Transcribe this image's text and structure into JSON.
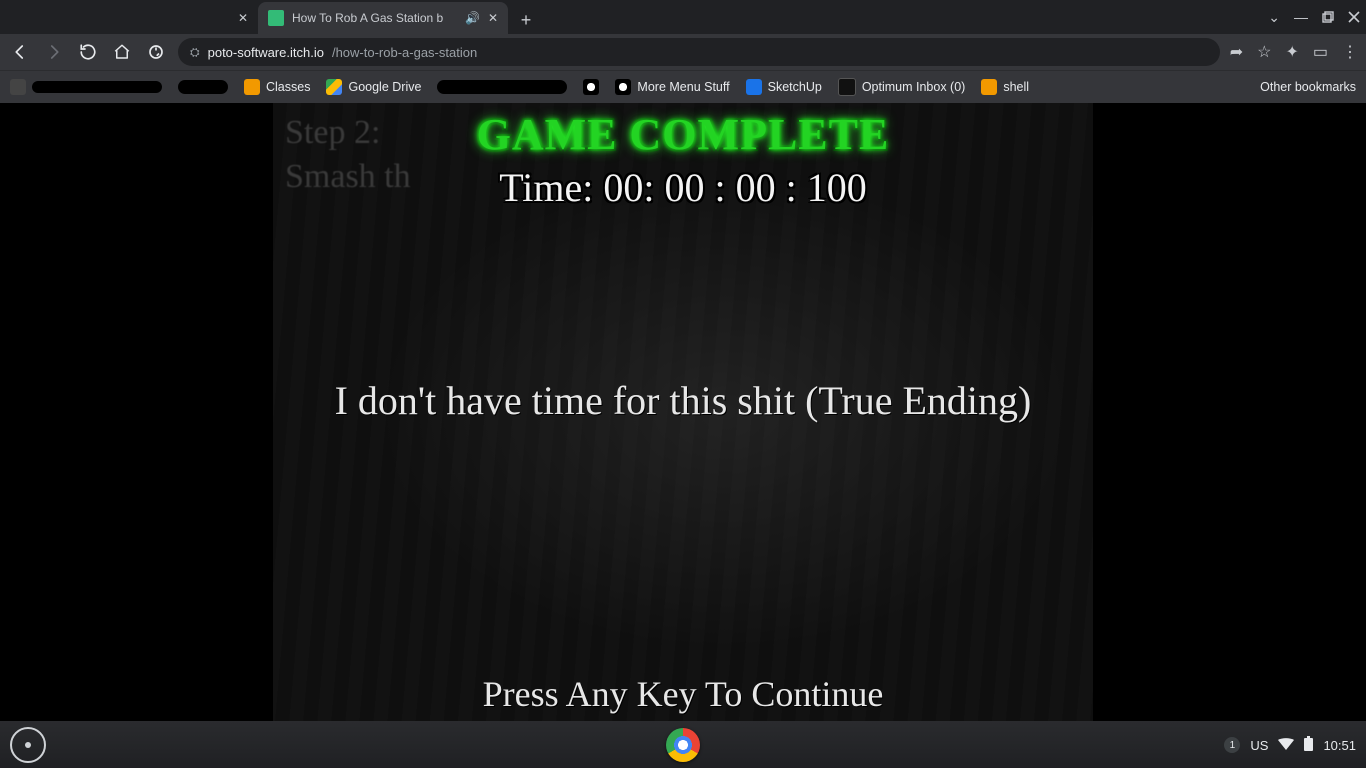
{
  "browser": {
    "tabs": {
      "inactive_close_glyph": "✕",
      "active": {
        "title": "How To Rob A Gas Station b",
        "audio_glyph": "🔊",
        "close_glyph": "✕"
      },
      "newtab_glyph": "+"
    },
    "window_controls": {
      "dropdown_glyph": "⌄",
      "minimize_glyph": "—"
    },
    "toolbar": {
      "secure_glyph": "⛭",
      "url_host": "poto-software.itch.io",
      "url_path": "/how-to-rob-a-gas-station",
      "share_glyph": "➦",
      "star_glyph": "☆",
      "ext_glyph": "✦",
      "panel_glyph": "▭",
      "menu_glyph": "⋮"
    },
    "bookmarks": {
      "items": [
        {
          "label": "Classes",
          "color": "#f29900"
        },
        {
          "label": "Google Drive",
          "color": "#34a853"
        },
        {
          "label": "More Menu Stuff",
          "color": "#9aa0a6"
        },
        {
          "label": "SketchUp",
          "color": "#1a73e8"
        },
        {
          "label": "Optimum Inbox (0)",
          "color": "#202124"
        },
        {
          "label": "shell",
          "color": "#f29900"
        }
      ],
      "other_label": "Other bookmarks"
    }
  },
  "game": {
    "bg_step_line1": "Step 2:",
    "bg_step_line2": "Smash th",
    "headline": "GAME COMPLETE",
    "timer_text": "Time: 00: 00 : 00 : 100",
    "ending_text": "I don't have time for this shit (True Ending)",
    "continue_text": "Press Any Key To Continue"
  },
  "shelf": {
    "notif_count": "1",
    "lang": "US",
    "wifi_glyph": "▲",
    "battery_glyph": "▮",
    "clock": "10:51"
  }
}
